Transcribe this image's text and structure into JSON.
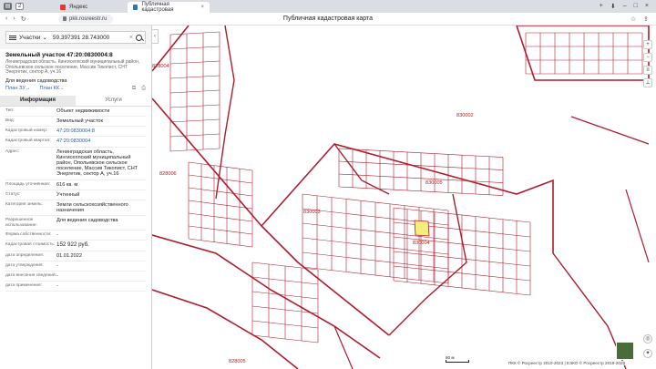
{
  "browser": {
    "tab_count": "2",
    "tabs": [
      {
        "label": "Яндекс",
        "active": false
      },
      {
        "label": "Публичная кадастровая",
        "active": true
      }
    ],
    "url": "pkk.rosreestr.ru",
    "page_title": "Публичная кадастровая карта"
  },
  "search": {
    "mode": "Участки",
    "query": "59.397391 28.743000",
    "clear": "×"
  },
  "object": {
    "title": "Земельный участок 47:20:0830004:8",
    "address": "Ленинградская область, Кингисеппский муниципальный район, Опольевское сельское поселение, Массив Тикопист, СНТ Энергетик, сектор А, уч.16",
    "use": "Для ведения садоводства",
    "plan_zu": "План ЗУ→",
    "plan_kk": "План КК→"
  },
  "tabs": {
    "info": "Информация",
    "services": "Услуги"
  },
  "fields": [
    {
      "label": "Тип:",
      "value": "Объект недвижимости",
      "link": false
    },
    {
      "label": "Вид:",
      "value": "Земельный участок",
      "link": false
    },
    {
      "label": "Кадастровый номер:",
      "value": "47:20:0830004:8",
      "link": true
    },
    {
      "label": "Кадастровый квартал:",
      "value": "47:20:0830004",
      "link": true
    },
    {
      "label": "Адрес:",
      "value": "Ленинградская область, Кингисеппский муниципальный район, Опольевское сельское поселение, Массив Тикопист, СНТ Энергетик, сектор А, уч.16",
      "link": false
    },
    {
      "label": "Площадь уточнённая:",
      "value": "616 кв. м",
      "link": false
    },
    {
      "label": "Статус:",
      "value": "Учтенный",
      "link": false
    },
    {
      "label": "Категория земель:",
      "value": "Земли сельскохозяйственного назначения",
      "link": false
    },
    {
      "label": "Разрешенное использование:",
      "value": "Для ведения садоводства",
      "link": false
    },
    {
      "label": "Форма собственности:",
      "value": "-",
      "link": false
    },
    {
      "label": "Кадастровая стоимость:",
      "value": "152 922 руб.",
      "link": false
    },
    {
      "label": "дата определения:",
      "value": "01.01.2022",
      "link": false
    },
    {
      "label": "дата утверждения:",
      "value": "-",
      "link": false
    },
    {
      "label": "дата внесения сведений:",
      "value": "-",
      "link": false
    },
    {
      "label": "дата применения:",
      "value": "-",
      "link": false
    }
  ],
  "map": {
    "labels": {
      "q830002": "830002",
      "q830003": "830003",
      "q830004": "830004",
      "q830005": "830005",
      "q828004": "828004",
      "q828005": "828005",
      "q828006": "828006"
    },
    "scale": "60 м",
    "copyright": "ПКК © Росреестр 2010-2023 | ЕЭКО © Росреестр 2019-2023",
    "border_color": "#b01c2e",
    "highlight_color": "#f3ef7a"
  }
}
